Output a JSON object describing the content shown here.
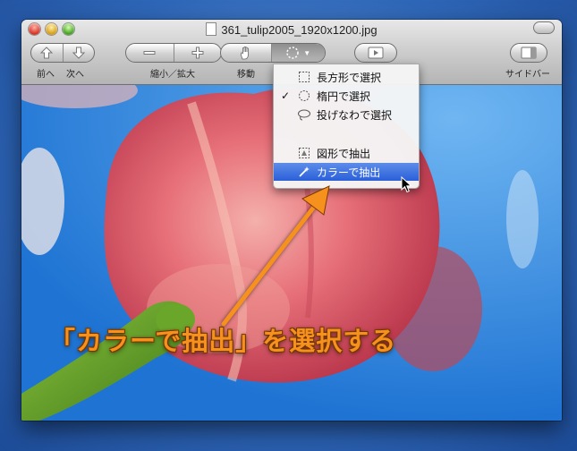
{
  "window": {
    "title": "361_tulip2005_1920x1200.jpg"
  },
  "toolbar": {
    "back_label": "前へ",
    "next_label": "次へ",
    "zoom_label": "縮小／拡大",
    "move_label": "移動",
    "sidebar_label": "サイドバー"
  },
  "selection_menu": {
    "items": [
      {
        "label": "長方形で選択",
        "checked": false,
        "highlighted": false
      },
      {
        "label": "楕円で選択",
        "checked": true,
        "highlighted": false
      },
      {
        "label": "投げなわで選択",
        "checked": false,
        "highlighted": false
      },
      {
        "label": "図形で抽出",
        "checked": false,
        "highlighted": false
      },
      {
        "label": "カラーで抽出",
        "checked": false,
        "highlighted": true
      }
    ],
    "check_mark": "✓"
  },
  "annotation": {
    "text": "「カラーで抽出」を選択する",
    "color": "#f6911e"
  },
  "colors": {
    "highlight": "#2a5fd9",
    "sky": "#2a83dd",
    "petal": "#e0606a",
    "stem": "#5a9a2a"
  }
}
